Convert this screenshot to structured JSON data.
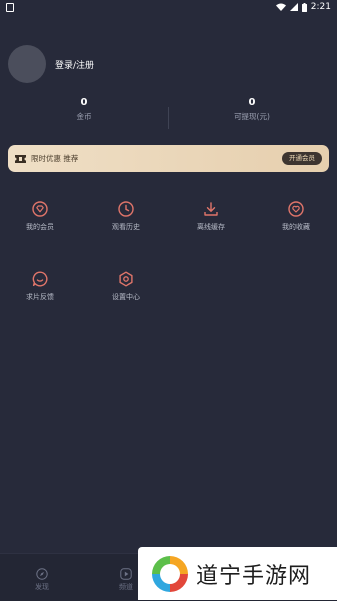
{
  "status_bar": {
    "time": "2:21"
  },
  "profile": {
    "login_label": "登录/注册"
  },
  "stats": [
    {
      "value": "0",
      "label": "金币"
    },
    {
      "value": "0",
      "label": "可提现(元)"
    }
  ],
  "vip_banner": {
    "text": "限时优惠 推荐",
    "button_label": "开通会员"
  },
  "menu": [
    {
      "label": "我的会员",
      "icon": "diamond-icon"
    },
    {
      "label": "观看历史",
      "icon": "clock-icon"
    },
    {
      "label": "离线缓存",
      "icon": "download-icon"
    },
    {
      "label": "我的收藏",
      "icon": "heart-icon"
    },
    {
      "label": "求片反馈",
      "icon": "feedback-icon"
    },
    {
      "label": "设置中心",
      "icon": "settings-icon"
    }
  ],
  "tabs": [
    {
      "label": "发现",
      "icon": "compass-icon"
    },
    {
      "label": "频道",
      "icon": "play-icon"
    }
  ],
  "watermark": {
    "text": "道宁手游网"
  },
  "colors": {
    "accent": "#e0756a",
    "background": "#272a3a",
    "banner": "#efdfc6"
  }
}
